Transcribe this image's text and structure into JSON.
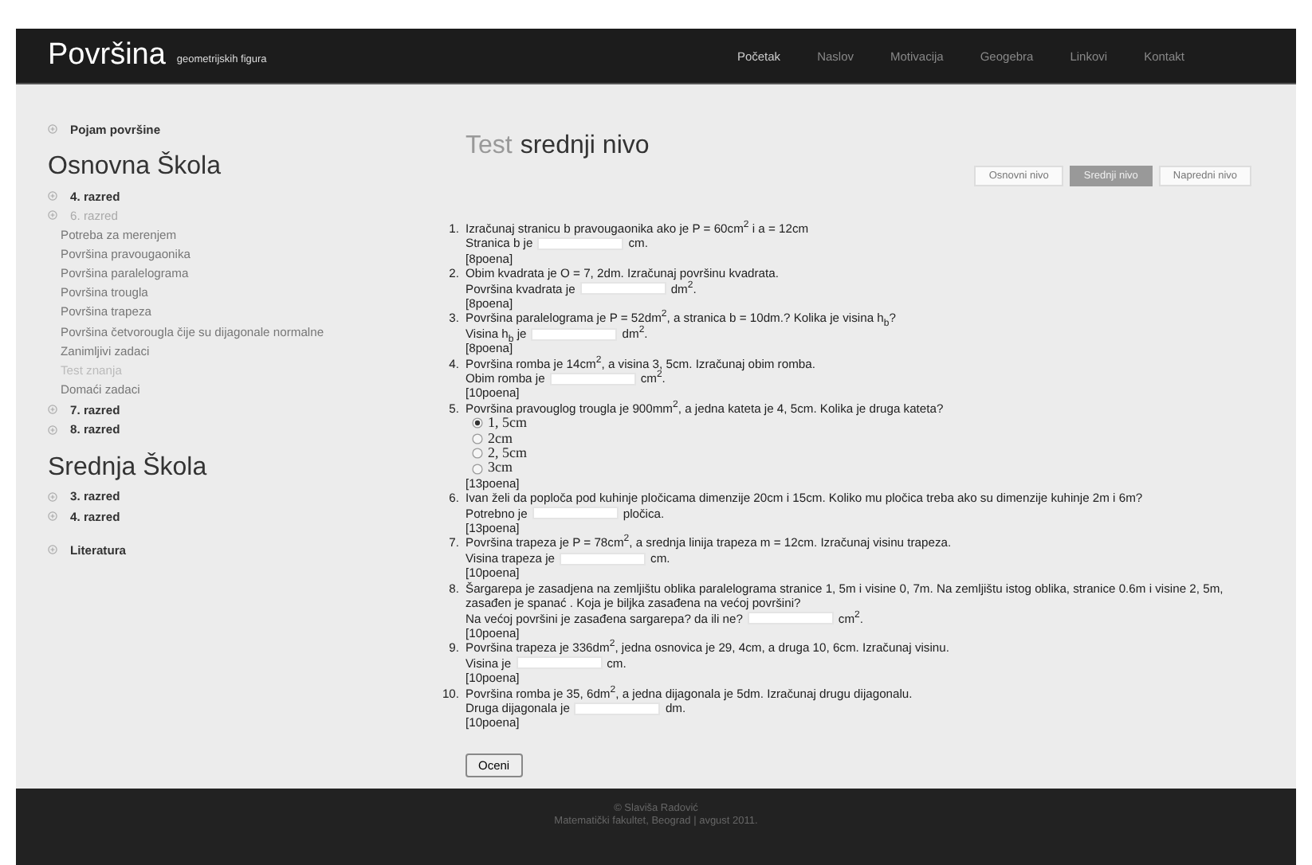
{
  "header": {
    "logo": "Površina",
    "tagline": "geometrijskih figura",
    "nav": [
      {
        "label": "Početak",
        "selected": true
      },
      {
        "label": "Naslov",
        "selected": false
      },
      {
        "label": "Motivacija",
        "selected": false
      },
      {
        "label": "Geogebra",
        "selected": false
      },
      {
        "label": "Linkovi",
        "selected": false
      },
      {
        "label": "Kontakt",
        "selected": false
      }
    ]
  },
  "sidebar": {
    "sections": [
      {
        "items": [
          {
            "label": "Pojam površine",
            "expanded": false
          }
        ]
      },
      {
        "title": "Osnovna Škola",
        "items": [
          {
            "label": "4. razred",
            "expanded": false
          },
          {
            "label": "6. razred",
            "expanded": true,
            "children": [
              {
                "label": "Potreba za merenjem",
                "selected": false
              },
              {
                "label": "Površina pravougaonika",
                "selected": false
              },
              {
                "label": "Površina paralelograma",
                "selected": false
              },
              {
                "label": "Površina trougla",
                "selected": false
              },
              {
                "label": "Površina trapeza",
                "selected": false
              },
              {
                "label": "Površina četvorougla čije su dijagonale normalne",
                "selected": false
              },
              {
                "label": "Zanimljivi zadaci",
                "selected": false
              },
              {
                "label": "Test znanja",
                "selected": true
              },
              {
                "label": "Domaći zadaci",
                "selected": false
              }
            ]
          },
          {
            "label": "7. razred",
            "expanded": false
          },
          {
            "label": "8. razred",
            "expanded": false
          }
        ]
      },
      {
        "title": "Srednja Škola",
        "items": [
          {
            "label": "3. razred",
            "expanded": false
          },
          {
            "label": "4. razred",
            "expanded": false
          }
        ]
      },
      {
        "items": [
          {
            "label": "Literatura",
            "expanded": false
          }
        ]
      }
    ]
  },
  "main": {
    "title_prefix": "Test",
    "title": "srednji nivo",
    "levels": [
      {
        "label": "Osnovni nivo",
        "selected": false
      },
      {
        "label": "Srednji nivo",
        "selected": true
      },
      {
        "label": "Napredni nivo",
        "selected": false
      }
    ],
    "questions": [
      {
        "number": "1.",
        "text": "Izračunaj stranicu b pravougaonika ako je P = 60cm$^{2}$ i a = 12cm",
        "kind": "input",
        "before": "Stranica b je",
        "after": "cm.",
        "points": "[8poena]"
      },
      {
        "number": "2.",
        "text": "Obim kvadrata je O = 7, 2dm. Izračunaj površinu kvadrata.",
        "kind": "input",
        "before": "Površina kvadrata je",
        "after": "dm$^{2}$.",
        "points": "[8poena]"
      },
      {
        "number": "3.",
        "text": "Površina paralelograma je P = 52dm$^{2}$, a stranica b = 10dm.? Kolika je visina h$_{b}$?",
        "kind": "input",
        "before": "Visina h$_{b}$ je",
        "after": "dm$^{2}$.",
        "points": "[8poena]"
      },
      {
        "number": "4.",
        "text": "Površina romba je 14cm$^{2}$, a visina 3, 5cm. Izračunaj obim romba.",
        "kind": "input",
        "before": "Obim romba je",
        "after": "cm$^{2}$.",
        "points": "[10poena]"
      },
      {
        "number": "5.",
        "text": "Površina pravouglog trougla je 900mm$^{2}$, a jedna kateta je 4, 5cm. Kolika je druga kateta?",
        "kind": "radio",
        "options": [
          {
            "label": "1, 5cm",
            "selected": true
          },
          {
            "label": "2cm",
            "selected": false
          },
          {
            "label": "2, 5cm",
            "selected": false
          },
          {
            "label": "3cm",
            "selected": false
          }
        ],
        "points": "[13poena]"
      },
      {
        "number": "6.",
        "text": "Ivan želi da poploča pod kuhinje pločicama dimenzije 20cm i 15cm. Koliko mu pločica treba ako su dimenzije kuhinje 2m i 6m?",
        "kind": "input",
        "before": "Potrebno je",
        "after": "pločica.",
        "points": "[13poena]"
      },
      {
        "number": "7.",
        "text": "Površina trapeza je P = 78cm$^{2}$, a srednja linija trapeza m = 12cm. Izračunaj visinu trapeza.",
        "kind": "input",
        "before": "Visina trapeza je",
        "after": "cm.",
        "points": "[10poena]"
      },
      {
        "number": "8.",
        "text": "Šargarepa je zasadjena na zemljištu oblika paralelograma stranice 1, 5m i visine 0, 7m. Na zemljištu istog oblika, stranice 0.6m i visine 2, 5m, zasađen je spanać . Koja je biljka zasađena na većoj površini?",
        "kind": "input",
        "before": "Na većoj površini je zasađena sargarepa? da ili ne?",
        "after": "cm$^{2}$.",
        "points": "[10poena]"
      },
      {
        "number": "9.",
        "text": "Površina trapeza je 336dm$^{2}$, jedna osnovica je 29, 4cm, a druga 10, 6cm. Izračunaj visinu.",
        "kind": "input",
        "before": "Visina je",
        "after": "cm.",
        "points": "[10poena]"
      },
      {
        "number": "10.",
        "text": "Površina romba je 35, 6dm$^{2}$, a jedna dijagonala je 5dm. Izračunaj drugu dijagonalu.",
        "kind": "input",
        "before": "Druga dijagonala je",
        "after": "dm.",
        "points": "[10poena]"
      }
    ],
    "submit": "Oceni"
  },
  "footer": {
    "lines": [
      "© Slaviša Radović",
      "Matematički fakultet, Beograd | avgust 2011."
    ]
  }
}
